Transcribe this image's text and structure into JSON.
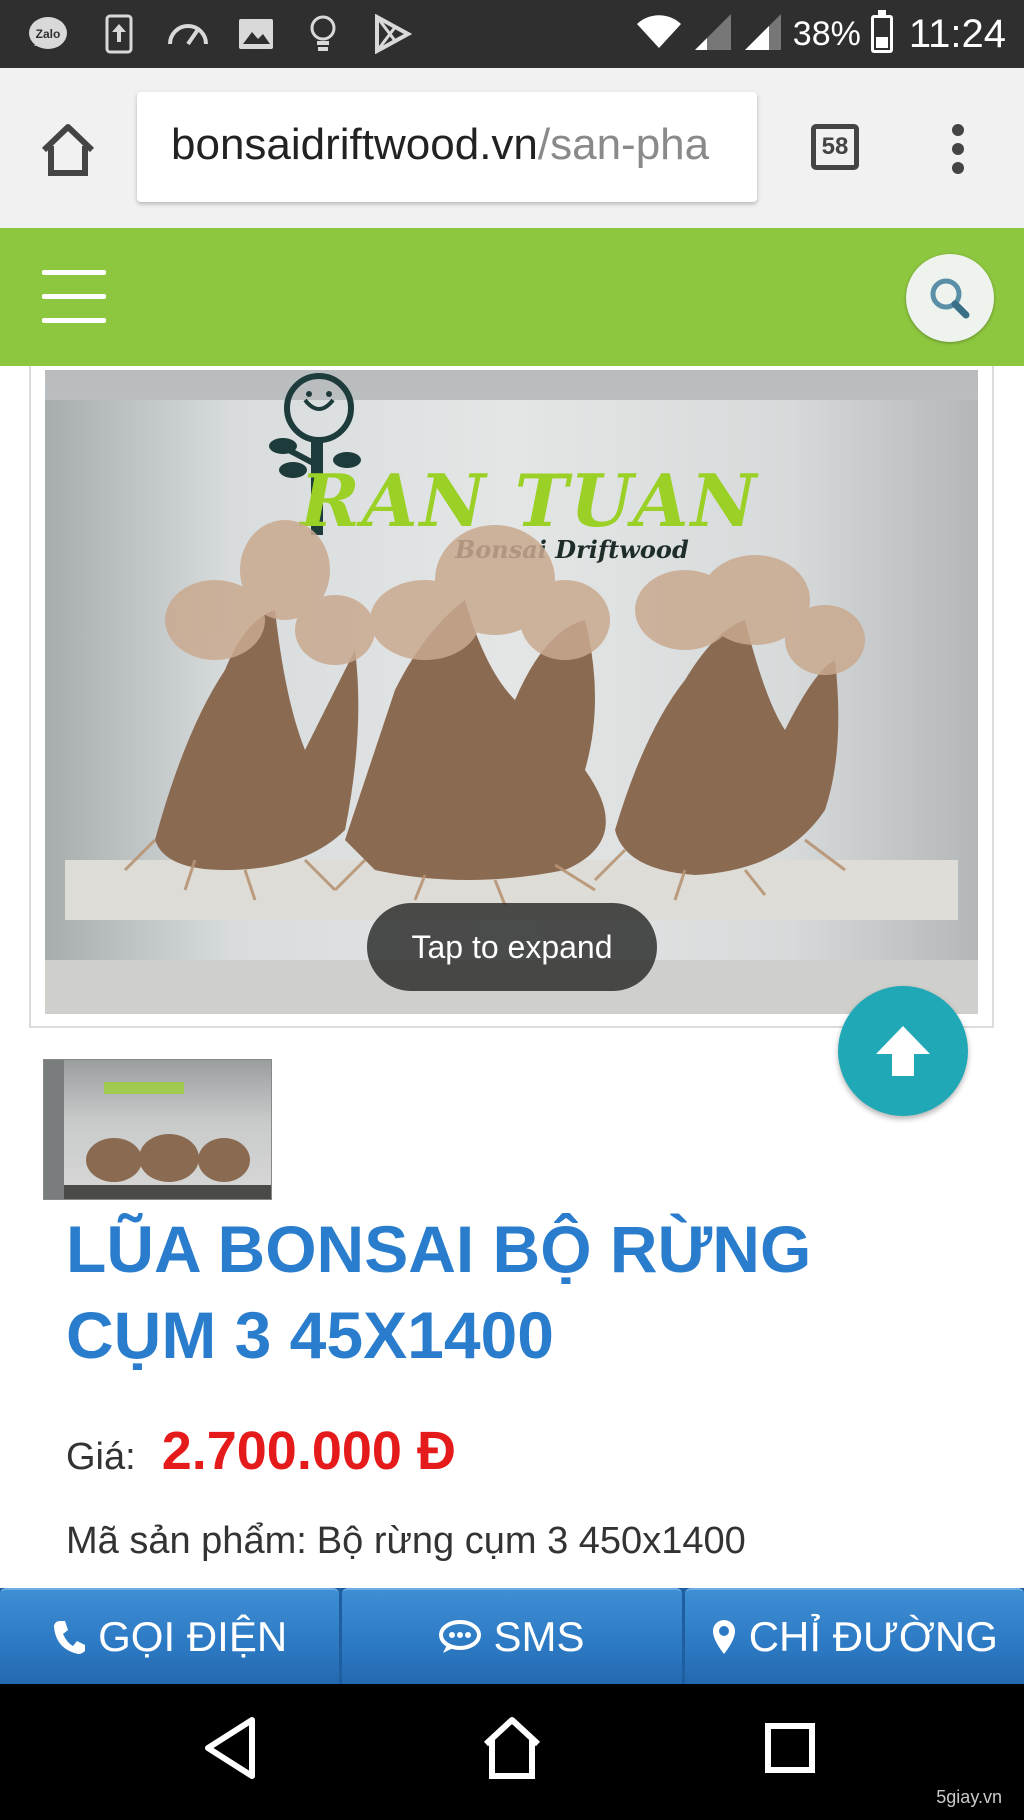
{
  "status_bar": {
    "battery_percent": "38%",
    "time": "11:24",
    "battery_level": 0.38,
    "icons": [
      "zalo-icon",
      "upload-icon",
      "speedometer-icon",
      "image-icon",
      "bulb-icon",
      "play-store-icon",
      "wifi-icon",
      "signal-icon",
      "signal-icon",
      "battery-icon"
    ],
    "zalo_label": "Zalo"
  },
  "browser": {
    "url_domain": "bonsaidriftwood.vn",
    "url_path": "/san-pha",
    "tab_count": "58"
  },
  "site_header": {
    "accent_color": "#8dc63f"
  },
  "product_image": {
    "logo_text": "RAN TUAN",
    "logo_sub": "Bonsai Driftwood",
    "tap_hint": "Tap to expand"
  },
  "product": {
    "title_line1": "LŨA BONSAI BỘ RỪNG",
    "title_line2": "CỤM 3 45X1400",
    "price_label": "Giá:",
    "price_value": "2.700.000 Đ",
    "sku_label": "Mã sản phẩm:",
    "sku_value": "Bộ rừng cụm 3 450x1400",
    "title_color": "#2a7dcc",
    "price_color": "#e51b1b"
  },
  "action_bar": {
    "call_label": "GỌI ĐIỆN",
    "sms_label": "SMS",
    "directions_label": "CHỈ ĐƯỜNG"
  },
  "watermark": "5giay.vn"
}
